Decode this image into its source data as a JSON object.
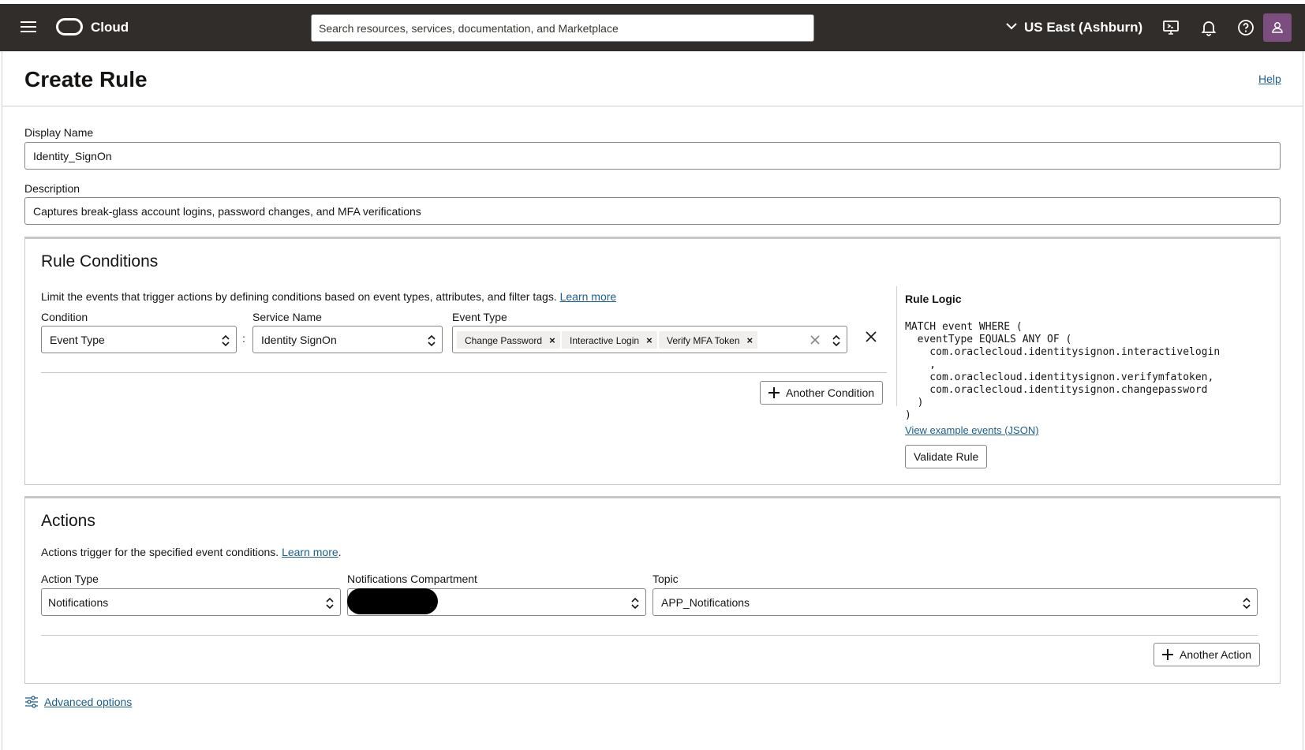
{
  "topbar": {
    "brand": "Cloud",
    "search_placeholder": "Search resources, services, documentation, and Marketplace",
    "region": "US East (Ashburn)",
    "icons": [
      "menu-icon",
      "oracle-logo",
      "chevron-down-icon",
      "cloud-shell-icon",
      "bell-icon",
      "help-icon",
      "avatar"
    ]
  },
  "page": {
    "title": "Create Rule",
    "help_label": "Help"
  },
  "form": {
    "display_name_label": "Display Name",
    "display_name_value": "Identity_SignOn",
    "description_label": "Description",
    "description_value": "Captures break-glass account logins, password changes, and MFA verifications"
  },
  "rule_conditions": {
    "title": "Rule Conditions",
    "intro": "Limit the events that trigger actions by defining conditions based on event types, attributes, and filter tags.",
    "learn_more": "Learn more",
    "condition_label": "Condition",
    "condition_value": "Event Type",
    "separator": ":",
    "service_label": "Service Name",
    "service_value": "Identity SignOn",
    "event_type_label": "Event Type",
    "event_types": [
      "Change Password",
      "Interactive Login",
      "Verify MFA Token"
    ],
    "add_condition": "Another Condition"
  },
  "rule_logic": {
    "title": "Rule Logic",
    "code": "MATCH event WHERE (\n  eventType EQUALS ANY OF (\n    com.oraclecloud.identitysignon.interactivelogin\n    ,\n    com.oraclecloud.identitysignon.verifymfatoken,\n    com.oraclecloud.identitysignon.changepassword\n  )\n)",
    "example_link": "View example events (JSON)",
    "validate_button": "Validate Rule"
  },
  "actions": {
    "title": "Actions",
    "intro": "Actions trigger for the specified event conditions.",
    "learn_more": "Learn more",
    "intro_end": ".",
    "action_type_label": "Action Type",
    "action_type_value": "Notifications",
    "compartment_label": "Notifications Compartment",
    "compartment_value": "",
    "topic_label": "Topic",
    "topic_value": "APP_Notifications",
    "add_action": "Another Action"
  },
  "advanced": {
    "label": "Advanced options"
  },
  "colors": {
    "topbar": "#312d2a",
    "link": "#1b5e8e",
    "avatar": "#7c4d7f"
  }
}
